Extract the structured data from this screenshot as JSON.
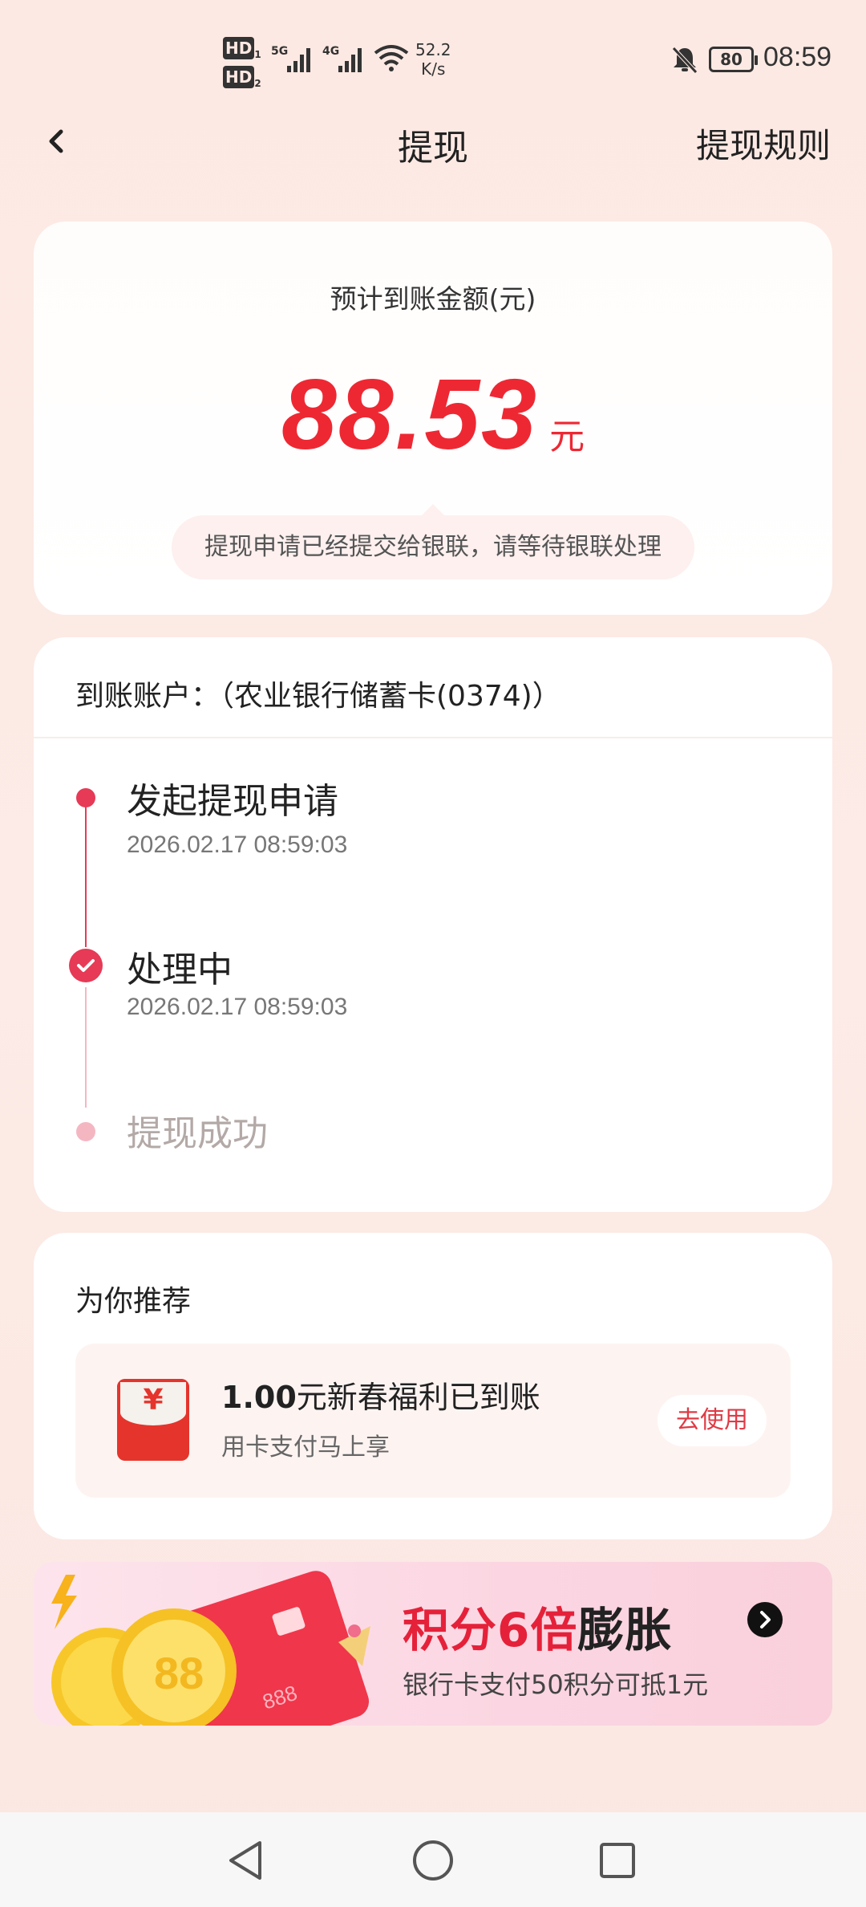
{
  "status_bar": {
    "hd1": "HD",
    "hd1_index": "1",
    "hd2": "HD",
    "hd2_index": "2",
    "net_5g": "5G",
    "net_4g": "4G",
    "speed_value": "52.2",
    "speed_unit": "K/s",
    "battery": "80",
    "time": "08:59"
  },
  "header": {
    "title": "提现",
    "rules_label": "提现规则"
  },
  "amount_card": {
    "label": "预计到账金额(元)",
    "amount": "88.53",
    "unit": "元",
    "notice": "提现申请已经提交给银联，请等待银联处理"
  },
  "progress_card": {
    "account": "到账账户：（农业银行储蓄卡(0374)）",
    "steps": [
      {
        "title": "发起提现申请",
        "time": "2026.02.17 08:59:03",
        "state": "done"
      },
      {
        "title": "处理中",
        "time": "2026.02.17 08:59:03",
        "state": "current"
      },
      {
        "title": "提现成功",
        "time": "",
        "state": "pending"
      }
    ]
  },
  "recommend": {
    "title": "为你推荐",
    "item": {
      "amount": "1.00",
      "text": "元新春福利已到账",
      "sub": "用卡支付马上享",
      "button": "去使用",
      "icon_symbol": "¥"
    }
  },
  "banner": {
    "title_red": "积分6倍",
    "title_black": "膨胀",
    "subtitle": "银行卡支付50积分可抵1元",
    "card_number": "888",
    "coin_number": "88"
  },
  "colors": {
    "accent": "#ee2833",
    "timeline": "#e63a56",
    "timeline_pending": "#f4b7c2",
    "background": "#fde9e3"
  },
  "icons": [
    "back-arrow-icon",
    "chevron-right-icon",
    "check-icon",
    "red-envelope-icon",
    "bell-off-icon",
    "wifi-icon",
    "signal-icon",
    "battery-icon",
    "nav-back-icon",
    "nav-home-icon",
    "nav-recents-icon"
  ]
}
